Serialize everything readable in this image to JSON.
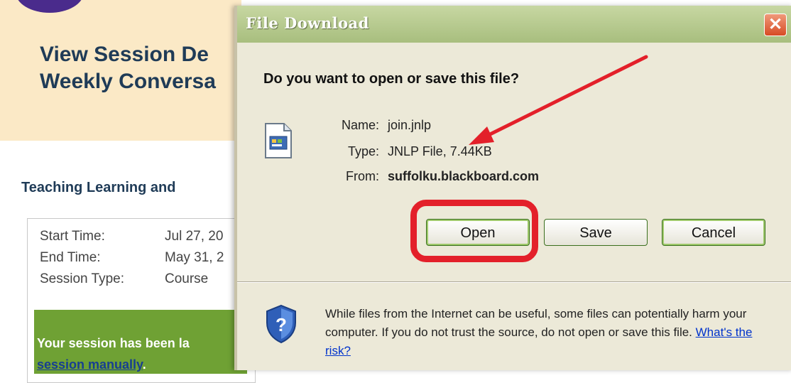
{
  "background_page": {
    "title_line1": "View Session De",
    "title_line2": "Weekly Conversa",
    "subheading": "Teaching Learning and",
    "session_details": [
      {
        "label": "Start Time:",
        "value": "Jul 27, 20"
      },
      {
        "label": "End Time:",
        "value": "May 31, 2"
      },
      {
        "label": "Session Type:",
        "value": "Course"
      }
    ],
    "launch_notice": "Your session has been la",
    "launch_link": "session manually",
    "launch_link_suffix": "."
  },
  "dialog": {
    "title": "File Download",
    "close_symbol": "✕",
    "question": "Do you want to open or save this file?",
    "file_info": [
      {
        "label": "Name:",
        "value": "join.jnlp"
      },
      {
        "label": "Type:",
        "value": "JNLP File, 7.44KB"
      },
      {
        "label": "From:",
        "value": "suffolku.blackboard.com"
      }
    ],
    "buttons": {
      "open": "Open",
      "save": "Save",
      "cancel": "Cancel"
    },
    "warning_text": "While files from the Internet can be useful, some files can potentially harm your computer. If you do not trust the source, do not open or save this file.",
    "warning_link": "What's the risk?",
    "accent_color": "#e3202a"
  }
}
